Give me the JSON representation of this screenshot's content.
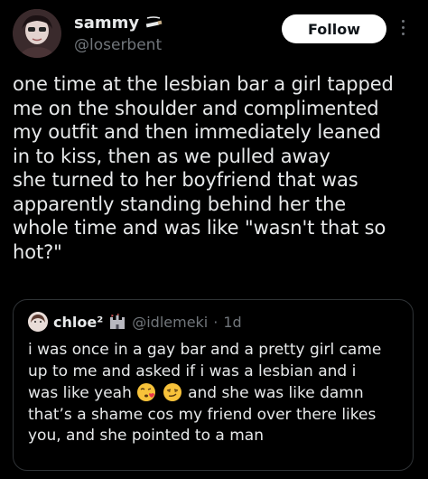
{
  "tweet": {
    "author": {
      "display_name": "sammy",
      "handle": "@loserbent",
      "badge_icon": "cigarette-icon"
    },
    "follow_label": "Follow",
    "text_lines": [
      "one time at the lesbian bar a girl tapped",
      "me on the shoulder and complimented",
      "my outfit and then immediately leaned",
      "in to kiss, then as we pulled away",
      "she turned to her boyfriend that was",
      "apparently standing behind her the",
      "whole time and was like \"wasn't that so",
      "hot?\""
    ]
  },
  "quote": {
    "display_name": "chloe²",
    "badge_icon": "castle-icon",
    "handle": "@idlemeki",
    "separator": "·",
    "time": "1d",
    "text_lines": [
      "i was once in a gay bar and a pretty girl came",
      "up to me and asked if i was a lesbian and i",
      "was like yeah",
      "and she was like damn",
      "that’s a shame cos my friend over there likes",
      "you, and she pointed to a man"
    ],
    "emojis": [
      "face-blowing-kiss-emoji",
      "smirking-face-emoji"
    ]
  },
  "colors": {
    "background": "#000000",
    "text": "#e7e9ea",
    "secondary": "#71767b",
    "border": "#2f3336",
    "follow_bg": "#ffffff"
  }
}
